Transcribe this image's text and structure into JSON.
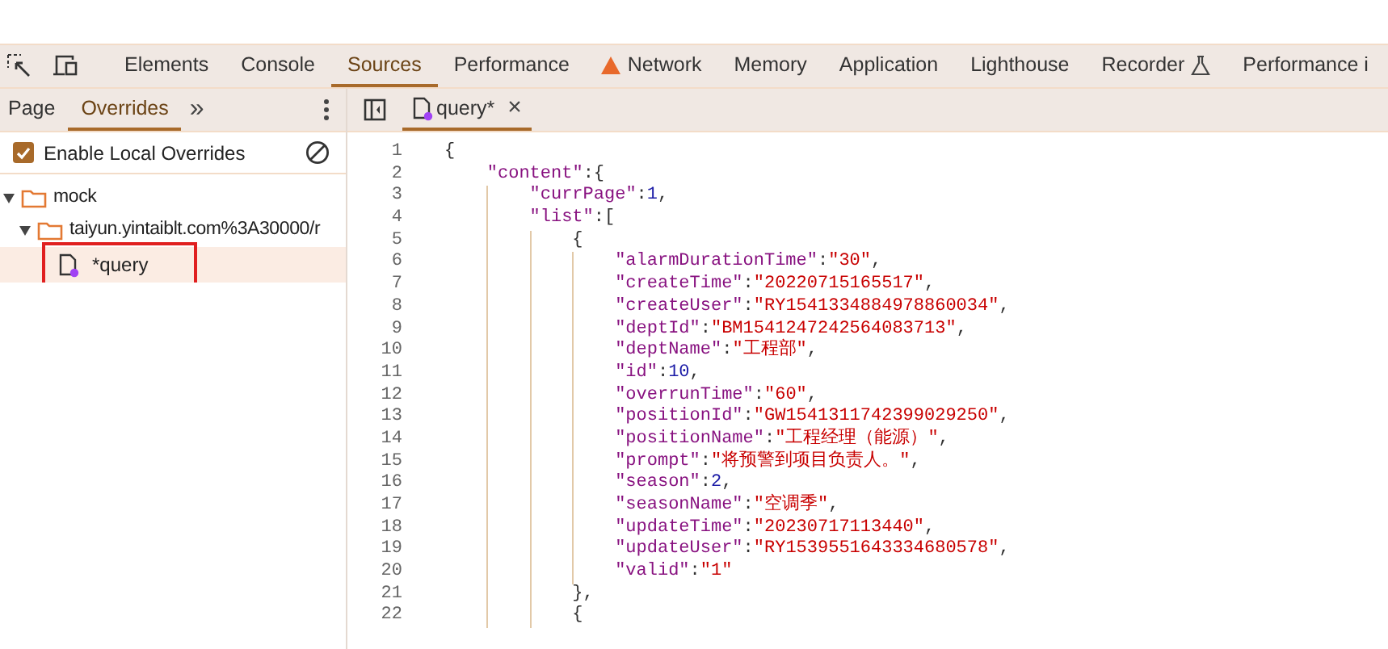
{
  "main_tabs": [
    {
      "label": "Elements",
      "selected": false,
      "kind": "plain"
    },
    {
      "label": "Console",
      "selected": false,
      "kind": "plain"
    },
    {
      "label": "Sources",
      "selected": true,
      "kind": "plain"
    },
    {
      "label": "Performance",
      "selected": false,
      "kind": "plain"
    },
    {
      "label": "Network",
      "selected": false,
      "kind": "warning"
    },
    {
      "label": "Memory",
      "selected": false,
      "kind": "plain"
    },
    {
      "label": "Application",
      "selected": false,
      "kind": "plain"
    },
    {
      "label": "Lighthouse",
      "selected": false,
      "kind": "plain"
    },
    {
      "label": "Recorder",
      "selected": false,
      "kind": "experimental"
    },
    {
      "label": "Performance i",
      "selected": false,
      "kind": "plain"
    }
  ],
  "navigator": {
    "tabs": [
      {
        "label": "Page",
        "selected": false
      },
      {
        "label": "Overrides",
        "selected": true
      }
    ],
    "more": "»",
    "enable_overrides": {
      "label": "Enable Local Overrides",
      "checked": true
    },
    "tree": [
      {
        "label": "mock",
        "kind": "folder",
        "selected": false,
        "children": [
          {
            "label": "taiyun.yintaiblt.com%3A30000/r",
            "kind": "folder",
            "selected": false,
            "children": [
              {
                "label": "*query",
                "kind": "file",
                "selected": true
              }
            ]
          }
        ]
      }
    ]
  },
  "editor": {
    "tabs": [
      {
        "label": "query*",
        "selected": true,
        "modified": true,
        "close": "×"
      }
    ],
    "lines": [
      {
        "n": "1",
        "tokens": [
          {
            "kind": "punct",
            "text": "{"
          }
        ]
      },
      {
        "n": "2",
        "tokens": [
          {
            "kind": "key",
            "text": "    \"content\""
          },
          {
            "kind": "punct",
            "text": ":{"
          }
        ]
      },
      {
        "n": "3",
        "tokens": [
          {
            "kind": "key",
            "text": "        \"currPage\""
          },
          {
            "kind": "punct",
            "text": ":"
          },
          {
            "kind": "number",
            "text": "1"
          },
          {
            "kind": "punct",
            "text": ","
          }
        ]
      },
      {
        "n": "4",
        "tokens": [
          {
            "kind": "key",
            "text": "        \"list\""
          },
          {
            "kind": "punct",
            "text": ":["
          }
        ]
      },
      {
        "n": "5",
        "tokens": [
          {
            "kind": "punct",
            "text": "            {"
          }
        ]
      },
      {
        "n": "6",
        "tokens": [
          {
            "kind": "key",
            "text": "                \"alarmDurationTime\""
          },
          {
            "kind": "punct",
            "text": ":"
          },
          {
            "kind": "string",
            "text": "\"30\""
          },
          {
            "kind": "punct",
            "text": ","
          }
        ]
      },
      {
        "n": "7",
        "tokens": [
          {
            "kind": "key",
            "text": "                \"createTime\""
          },
          {
            "kind": "punct",
            "text": ":"
          },
          {
            "kind": "string",
            "text": "\"20220715165517\""
          },
          {
            "kind": "punct",
            "text": ","
          }
        ]
      },
      {
        "n": "8",
        "tokens": [
          {
            "kind": "key",
            "text": "                \"createUser\""
          },
          {
            "kind": "punct",
            "text": ":"
          },
          {
            "kind": "string",
            "text": "\"RY1541334884978860034\""
          },
          {
            "kind": "punct",
            "text": ","
          }
        ]
      },
      {
        "n": "9",
        "tokens": [
          {
            "kind": "key",
            "text": "                \"deptId\""
          },
          {
            "kind": "punct",
            "text": ":"
          },
          {
            "kind": "string",
            "text": "\"BM1541247242564083713\""
          },
          {
            "kind": "punct",
            "text": ","
          }
        ]
      },
      {
        "n": "10",
        "tokens": [
          {
            "kind": "key",
            "text": "                \"deptName\""
          },
          {
            "kind": "punct",
            "text": ":"
          },
          {
            "kind": "string",
            "text": "\"工程部\""
          },
          {
            "kind": "punct",
            "text": ","
          }
        ]
      },
      {
        "n": "11",
        "tokens": [
          {
            "kind": "key",
            "text": "                \"id\""
          },
          {
            "kind": "punct",
            "text": ":"
          },
          {
            "kind": "number",
            "text": "10"
          },
          {
            "kind": "punct",
            "text": ","
          }
        ]
      },
      {
        "n": "12",
        "tokens": [
          {
            "kind": "key",
            "text": "                \"overrunTime\""
          },
          {
            "kind": "punct",
            "text": ":"
          },
          {
            "kind": "string",
            "text": "\"60\""
          },
          {
            "kind": "punct",
            "text": ","
          }
        ]
      },
      {
        "n": "13",
        "tokens": [
          {
            "kind": "key",
            "text": "                \"positionId\""
          },
          {
            "kind": "punct",
            "text": ":"
          },
          {
            "kind": "string",
            "text": "\"GW1541311742399029250\""
          },
          {
            "kind": "punct",
            "text": ","
          }
        ]
      },
      {
        "n": "14",
        "tokens": [
          {
            "kind": "key",
            "text": "                \"positionName\""
          },
          {
            "kind": "punct",
            "text": ":"
          },
          {
            "kind": "string",
            "text": "\"工程经理（能源）\""
          },
          {
            "kind": "punct",
            "text": ","
          }
        ]
      },
      {
        "n": "15",
        "tokens": [
          {
            "kind": "key",
            "text": "                \"prompt\""
          },
          {
            "kind": "punct",
            "text": ":"
          },
          {
            "kind": "string",
            "text": "\"将预警到项目负责人。\""
          },
          {
            "kind": "punct",
            "text": ","
          }
        ]
      },
      {
        "n": "16",
        "tokens": [
          {
            "kind": "key",
            "text": "                \"season\""
          },
          {
            "kind": "punct",
            "text": ":"
          },
          {
            "kind": "number",
            "text": "2"
          },
          {
            "kind": "punct",
            "text": ","
          }
        ]
      },
      {
        "n": "17",
        "tokens": [
          {
            "kind": "key",
            "text": "                \"seasonName\""
          },
          {
            "kind": "punct",
            "text": ":"
          },
          {
            "kind": "string",
            "text": "\"空调季\""
          },
          {
            "kind": "punct",
            "text": ","
          }
        ]
      },
      {
        "n": "18",
        "tokens": [
          {
            "kind": "key",
            "text": "                \"updateTime\""
          },
          {
            "kind": "punct",
            "text": ":"
          },
          {
            "kind": "string",
            "text": "\"20230717113440\""
          },
          {
            "kind": "punct",
            "text": ","
          }
        ]
      },
      {
        "n": "19",
        "tokens": [
          {
            "kind": "key",
            "text": "                \"updateUser\""
          },
          {
            "kind": "punct",
            "text": ":"
          },
          {
            "kind": "string",
            "text": "\"RY1539551643334680578\""
          },
          {
            "kind": "punct",
            "text": ","
          }
        ]
      },
      {
        "n": "20",
        "tokens": [
          {
            "kind": "key",
            "text": "                \"valid\""
          },
          {
            "kind": "punct",
            "text": ":"
          },
          {
            "kind": "string",
            "text": "\"1\""
          }
        ]
      },
      {
        "n": "21",
        "tokens": [
          {
            "kind": "punct",
            "text": "            },"
          }
        ]
      },
      {
        "n": "22",
        "tokens": [
          {
            "kind": "punct",
            "text": "            {"
          }
        ]
      }
    ]
  }
}
